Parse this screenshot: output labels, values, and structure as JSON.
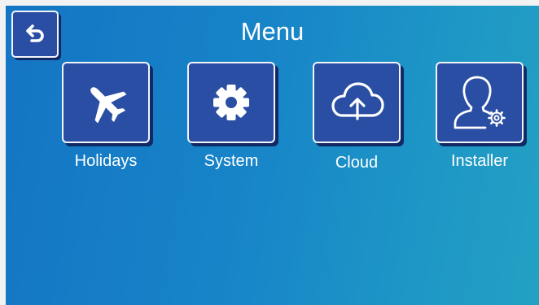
{
  "header": {
    "title": "Menu",
    "back_icon": "back-arrow-icon"
  },
  "menu": {
    "items": [
      {
        "label": "Holidays",
        "icon": "airplane-icon"
      },
      {
        "label": "System",
        "icon": "gear-icon"
      },
      {
        "label": "Cloud",
        "icon": "cloud-upload-icon"
      },
      {
        "label": "Installer",
        "icon": "user-settings-icon"
      }
    ]
  },
  "colors": {
    "background_start": "#1475c4",
    "background_end": "#23a1c3",
    "tile": "#2a4ea3",
    "tile_shadow": "#112a66",
    "text": "#ffffff"
  }
}
